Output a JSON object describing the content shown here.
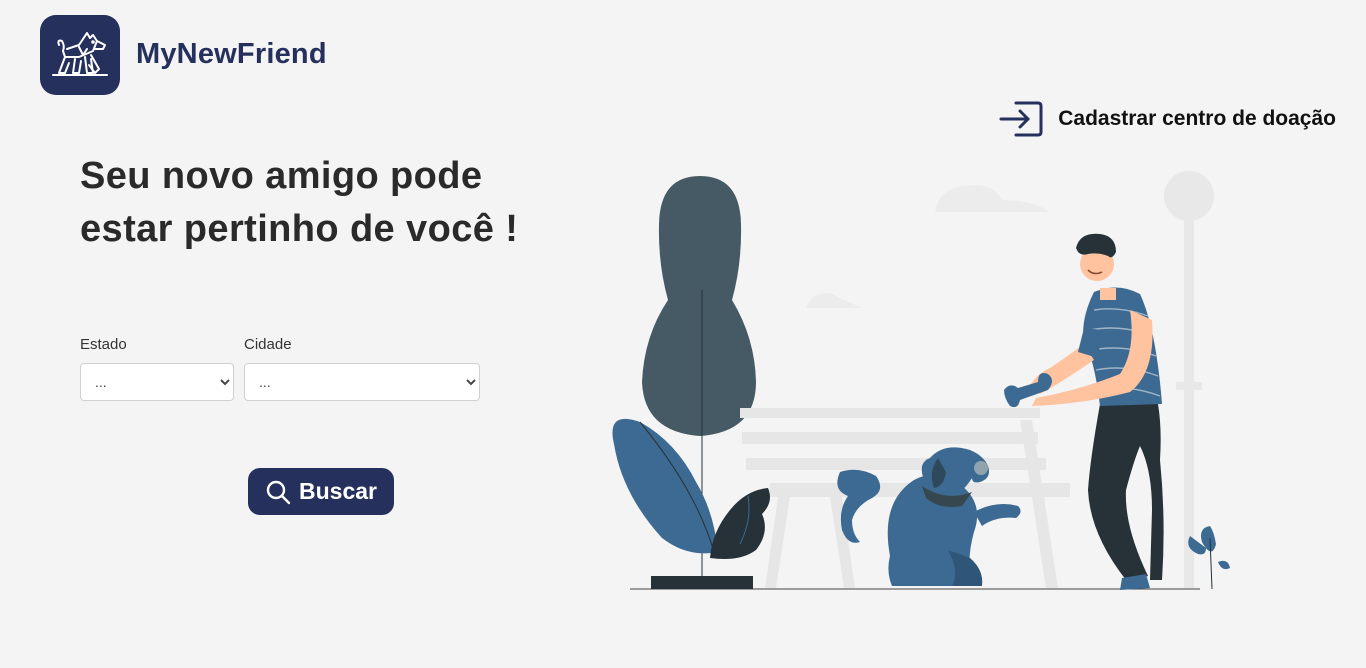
{
  "header": {
    "brand": "MyNewFriend",
    "logo_icon": "dog-icon",
    "register_link": {
      "label": "Cadastrar centro de doação",
      "icon": "sign-in-icon"
    }
  },
  "hero": {
    "line1": "Seu novo amigo pode",
    "line2": "estar pertinho de você !"
  },
  "form": {
    "estado": {
      "label": "Estado",
      "selected": "..."
    },
    "cidade": {
      "label": "Cidade",
      "selected": "..."
    },
    "search_button": {
      "label": "Buscar",
      "icon": "search-icon"
    }
  },
  "colors": {
    "primary": "#25305c",
    "background": "#f4f4f4",
    "illustration_blue": "#3d6a92",
    "illustration_dark": "#263238"
  }
}
